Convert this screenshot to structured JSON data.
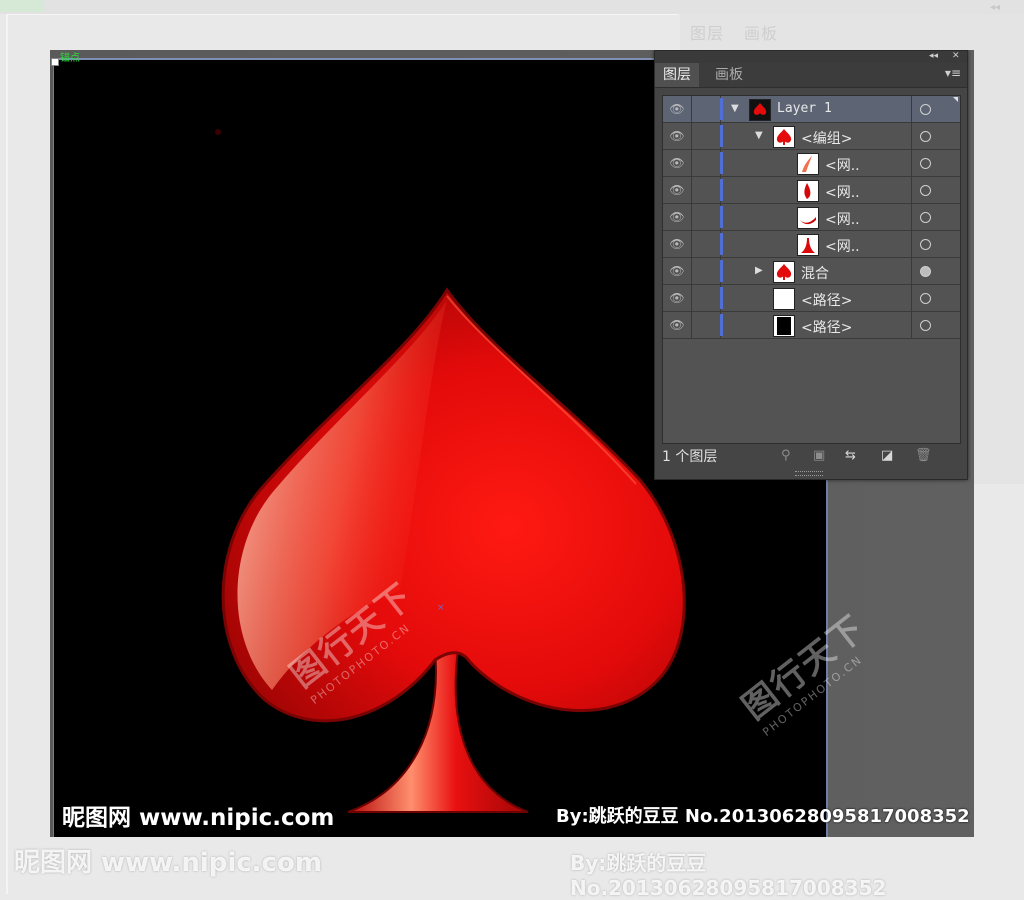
{
  "anchor_label": "锚点",
  "panel": {
    "tabs": [
      "图层",
      "画板"
    ],
    "controls": {
      "collapse": "◂◂",
      "close": "✕",
      "menu": "▾≡"
    },
    "layers": [
      {
        "label": "Layer 1",
        "indent": 0,
        "expander": "▼",
        "thumb": "spade",
        "target": "ring",
        "mono": true
      },
      {
        "label": "<编组>",
        "indent": 1,
        "expander": "▼",
        "thumb": "spade-white",
        "target": "ring"
      },
      {
        "label": "<网..",
        "indent": 2,
        "expander": "",
        "thumb": "shard",
        "target": "ring"
      },
      {
        "label": "<网..",
        "indent": 2,
        "expander": "",
        "thumb": "drop",
        "target": "ring"
      },
      {
        "label": "<网..",
        "indent": 2,
        "expander": "",
        "thumb": "curve",
        "target": "ring"
      },
      {
        "label": "<网..",
        "indent": 2,
        "expander": "",
        "thumb": "stem",
        "target": "ring"
      },
      {
        "label": "混合",
        "indent": 1,
        "expander": "▶",
        "thumb": "spade-white",
        "target": "filled"
      },
      {
        "label": "<路径>",
        "indent": 1,
        "expander": "",
        "thumb": "white",
        "target": "ring"
      },
      {
        "label": "<路径>",
        "indent": 1,
        "expander": "",
        "thumb": "black",
        "target": "ring"
      }
    ],
    "footer": {
      "layer_count": "1 个图层",
      "icons": [
        "search-icon",
        "clipping-mask-icon",
        "new-sublayer-icon",
        "new-layer-icon",
        "delete-icon"
      ]
    }
  },
  "watermarks": {
    "cn_text": "图行天下",
    "url_text": "PHOTOPHOTO.CN"
  },
  "bottom": {
    "site": "昵图网 www.nipic.com",
    "credit": "By:跳跃的豆豆 No.20130628095817008352"
  },
  "colors": {
    "accent": "#4f6fd6",
    "spade_red": "#e30b0b",
    "anchor_green": "#2bd93c"
  }
}
